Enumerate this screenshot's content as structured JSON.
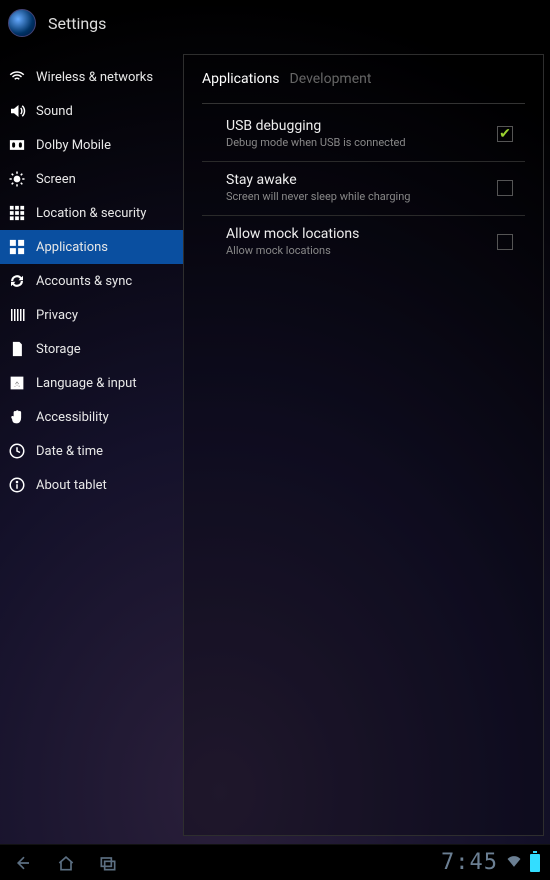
{
  "header": {
    "title": "Settings"
  },
  "sidebar": {
    "items": [
      {
        "label": "Wireless & networks",
        "icon": "wifi"
      },
      {
        "label": "Sound",
        "icon": "sound"
      },
      {
        "label": "Dolby Mobile",
        "icon": "dolby"
      },
      {
        "label": "Screen",
        "icon": "screen"
      },
      {
        "label": "Location & security",
        "icon": "location"
      },
      {
        "label": "Applications",
        "icon": "apps"
      },
      {
        "label": "Accounts & sync",
        "icon": "sync"
      },
      {
        "label": "Privacy",
        "icon": "privacy"
      },
      {
        "label": "Storage",
        "icon": "storage"
      },
      {
        "label": "Language & input",
        "icon": "language"
      },
      {
        "label": "Accessibility",
        "icon": "accessibility"
      },
      {
        "label": "Date & time",
        "icon": "datetime"
      },
      {
        "label": "About tablet",
        "icon": "about"
      }
    ],
    "active_index": 5
  },
  "breadcrumb": {
    "root": "Applications",
    "leaf": "Development"
  },
  "options": [
    {
      "title": "USB debugging",
      "subtitle": "Debug mode when USB is connected",
      "checked": true
    },
    {
      "title": "Stay awake",
      "subtitle": "Screen will never sleep while charging",
      "checked": false
    },
    {
      "title": "Allow mock locations",
      "subtitle": "Allow mock locations",
      "checked": false
    }
  ],
  "systembar": {
    "clock": "7:45"
  }
}
